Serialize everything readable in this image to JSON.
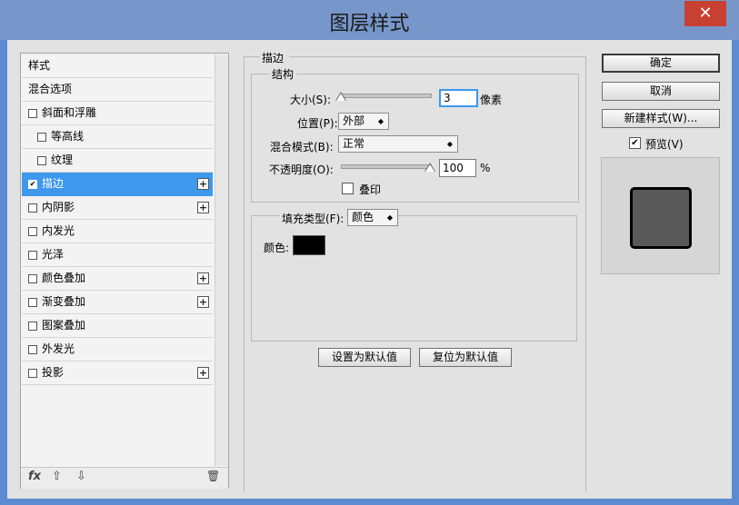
{
  "window": {
    "title": "图层样式",
    "close_glyph": "✕"
  },
  "styles_list": [
    {
      "label": "样式",
      "indent": 0,
      "checkbox": false,
      "checked": false,
      "plus": false,
      "selected": false
    },
    {
      "label": "混合选项",
      "indent": 0,
      "checkbox": false,
      "checked": false,
      "plus": false,
      "selected": false
    },
    {
      "label": "斜面和浮雕",
      "indent": 0,
      "checkbox": true,
      "checked": false,
      "plus": false,
      "selected": false
    },
    {
      "label": "等高线",
      "indent": 1,
      "checkbox": true,
      "checked": false,
      "plus": false,
      "selected": false
    },
    {
      "label": "纹理",
      "indent": 1,
      "checkbox": true,
      "checked": false,
      "plus": false,
      "selected": false
    },
    {
      "label": "描边",
      "indent": 0,
      "checkbox": true,
      "checked": true,
      "plus": true,
      "selected": true
    },
    {
      "label": "内阴影",
      "indent": 0,
      "checkbox": true,
      "checked": false,
      "plus": true,
      "selected": false
    },
    {
      "label": "内发光",
      "indent": 0,
      "checkbox": true,
      "checked": false,
      "plus": false,
      "selected": false
    },
    {
      "label": "光泽",
      "indent": 0,
      "checkbox": true,
      "checked": false,
      "plus": false,
      "selected": false
    },
    {
      "label": "颜色叠加",
      "indent": 0,
      "checkbox": true,
      "checked": false,
      "plus": true,
      "selected": false
    },
    {
      "label": "渐变叠加",
      "indent": 0,
      "checkbox": true,
      "checked": false,
      "plus": true,
      "selected": false
    },
    {
      "label": "图案叠加",
      "indent": 0,
      "checkbox": true,
      "checked": false,
      "plus": false,
      "selected": false
    },
    {
      "label": "外发光",
      "indent": 0,
      "checkbox": true,
      "checked": false,
      "plus": false,
      "selected": false
    },
    {
      "label": "投影",
      "indent": 0,
      "checkbox": true,
      "checked": false,
      "plus": true,
      "selected": false
    }
  ],
  "toolbar": {
    "fx_label": "fx",
    "up_glyph": "⇧",
    "down_glyph": "⇩",
    "trash_glyph": "🗑"
  },
  "stroke": {
    "section_title": "描边",
    "structure_title": "结构",
    "size_label": "大小(S):",
    "size_value": "3",
    "size_unit": "像素",
    "size_fraction": 0.0,
    "position_label": "位置(P):",
    "position_value": "外部",
    "blend_label": "混合模式(B):",
    "blend_value": "正常",
    "opacity_label": "不透明度(O):",
    "opacity_value": "100",
    "opacity_unit": "%",
    "opacity_fraction": 1.0,
    "overprint_label": "叠印",
    "fill_type_label": "填充类型(F):",
    "fill_type_value": "颜色",
    "color_label": "颜色:",
    "color_swatch": "#000000",
    "set_default": "设置为默认值",
    "reset_default": "复位为默认值"
  },
  "actions": {
    "ok": "确定",
    "cancel": "取消",
    "new_style": "新建样式(W)...",
    "preview_label": "预览(V)",
    "preview_checked": true
  },
  "colors": {
    "accent": "#3d98ee",
    "preview_fill": "#595959",
    "preview_stroke": "#000000"
  }
}
